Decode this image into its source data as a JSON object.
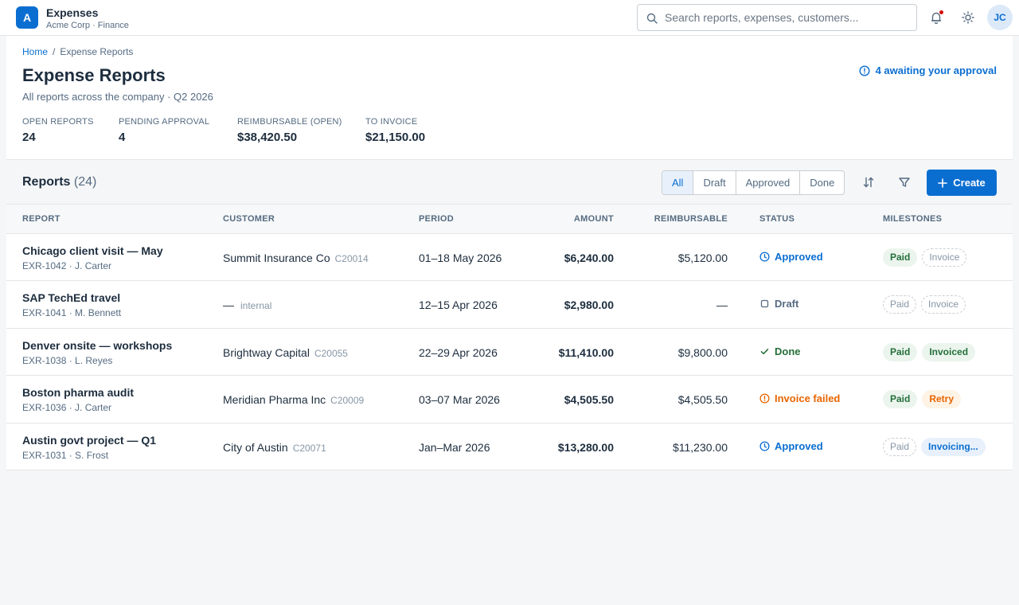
{
  "app": {
    "logo_letter": "A",
    "title": "Expenses",
    "subtitle": "Acme Corp · Finance",
    "search_placeholder": "Search reports, expenses, customers...",
    "avatar_initials": "JC"
  },
  "breadcrumb": {
    "home": "Home",
    "separator": "/",
    "current": "Expense Reports"
  },
  "page": {
    "title": "Expense Reports",
    "subtitle": "All reports across the company · Q2 2026",
    "approval_notice": "4 awaiting your approval"
  },
  "kpis": [
    {
      "label": "Open reports",
      "value": "24"
    },
    {
      "label": "Pending approval",
      "value": "4"
    },
    {
      "label": "Reimbursable (open)",
      "value": "$38,420.50"
    },
    {
      "label": "To invoice",
      "value": "$21,150.00"
    }
  ],
  "toolbar": {
    "title": "Reports",
    "count": "(24)",
    "filters": [
      "All",
      "Draft",
      "Approved",
      "Done"
    ],
    "active_filter": "All",
    "create_label": "Create"
  },
  "columns": [
    "REPORT",
    "CUSTOMER",
    "PERIOD",
    "AMOUNT",
    "REIMBURSABLE",
    "STATUS",
    "MILESTONES"
  ],
  "rows": [
    {
      "title": "Chicago client visit — May",
      "meta": "EXR-1042 · J. Carter",
      "customer": "Summit Insurance Co",
      "customer_id": "C20014",
      "period": "01–18 May 2026",
      "amount": "$6,240.00",
      "reimbursable": "$5,120.00",
      "status": "Approved",
      "milestones": [
        "Paid",
        "Invoice"
      ]
    },
    {
      "title": "SAP TechEd travel",
      "meta": "EXR-1041 · M. Bennett",
      "customer": "—",
      "customer_id": "internal",
      "period": "12–15 Apr 2026",
      "amount": "$2,980.00",
      "reimbursable": "—",
      "status": "Draft",
      "milestones": [
        "Paid",
        "Invoice"
      ]
    },
    {
      "title": "Denver onsite — workshops",
      "meta": "EXR-1038 · L. Reyes",
      "customer": "Brightway Capital",
      "customer_id": "C20055",
      "period": "22–29 Apr 2026",
      "amount": "$11,410.00",
      "reimbursable": "$9,800.00",
      "status": "Done",
      "milestones": [
        "Paid",
        "Invoiced"
      ]
    },
    {
      "title": "Boston pharma audit",
      "meta": "EXR-1036 · J. Carter",
      "customer": "Meridian Pharma Inc",
      "customer_id": "C20009",
      "period": "03–07 Mar 2026",
      "amount": "$4,505.50",
      "reimbursable": "$4,505.50",
      "status": "Invoice failed",
      "milestones": [
        "Paid",
        "Retry"
      ]
    },
    {
      "title": "Austin govt project — Q1",
      "meta": "EXR-1031 · S. Frost",
      "customer": "City of Austin",
      "customer_id": "C20071",
      "period": "Jan–Mar 2026",
      "amount": "$13,280.00",
      "reimbursable": "$11,230.00",
      "status": "Approved",
      "milestones": [
        "Paid",
        "Invoicing..."
      ]
    }
  ],
  "colors": {
    "brand": "#0a6ed1",
    "positive": "#256f3a",
    "critical": "#e76500",
    "notification": "#d20a0a"
  },
  "icons": {
    "search": "search-icon",
    "bell": "bell-icon",
    "theme": "sun-icon",
    "info": "info-circle-icon",
    "sort": "sort-icon",
    "filter": "filter-icon",
    "create": "plus-icon",
    "approved": "clock-icon",
    "draft": "square-icon",
    "done": "checkmark-icon",
    "failed": "warning-circle-icon"
  }
}
